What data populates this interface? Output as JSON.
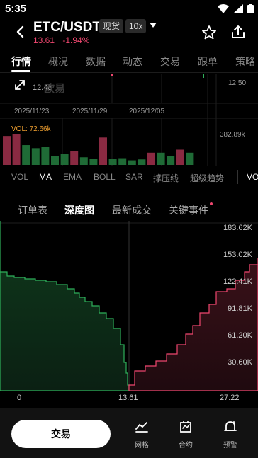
{
  "status": {
    "time": "5:35"
  },
  "header": {
    "pair": "ETC/USDT",
    "market_type": "现货",
    "leverage": "10x",
    "price": "13.61",
    "change": "-1.94%"
  },
  "main_tabs": [
    "行情",
    "概况",
    "数据",
    "动态",
    "交易",
    "跟单",
    "策略"
  ],
  "kline": {
    "price_low_label": "12.48",
    "axis_price": "12.50",
    "watermark": "欧易",
    "dates": [
      "2025/11/23",
      "2025/11/29",
      "2025/12/05"
    ],
    "vol_label": "VOL: 72.66k",
    "vol_axis": "382.89k",
    "volume_bars": [
      {
        "v": 0.95,
        "c": "r"
      },
      {
        "v": 1.0,
        "c": "r"
      },
      {
        "v": 0.65,
        "c": "g"
      },
      {
        "v": 0.55,
        "c": "g"
      },
      {
        "v": 0.6,
        "c": "g"
      },
      {
        "v": 0.3,
        "c": "g"
      },
      {
        "v": 0.35,
        "c": "g"
      },
      {
        "v": 0.45,
        "c": "r"
      },
      {
        "v": 0.25,
        "c": "g"
      },
      {
        "v": 0.2,
        "c": "g"
      },
      {
        "v": 0.9,
        "c": "r"
      },
      {
        "v": 0.2,
        "c": "g"
      },
      {
        "v": 0.22,
        "c": "g"
      },
      {
        "v": 0.15,
        "c": "g"
      },
      {
        "v": 0.18,
        "c": "g"
      },
      {
        "v": 0.4,
        "c": "r"
      },
      {
        "v": 0.4,
        "c": "g"
      },
      {
        "v": 0.28,
        "c": "g"
      },
      {
        "v": 0.5,
        "c": "r"
      },
      {
        "v": 0.4,
        "c": "g"
      }
    ]
  },
  "indicators": [
    "VOL",
    "MA",
    "EMA",
    "BOLL",
    "SAR",
    "撑压线",
    "超级趋势",
    "VO"
  ],
  "sub_tabs": [
    "订单表",
    "深度图",
    "最新成交",
    "关键事件"
  ],
  "depth": {
    "y_ticks": [
      "183.62K",
      "153.02K",
      "122.41K",
      "91.81K",
      "61.20K",
      "30.60K"
    ],
    "x_ticks": [
      "0",
      "13.61",
      "27.22"
    ]
  },
  "bottom": {
    "trade_label": "交易",
    "nav": [
      {
        "label": "网格",
        "icon": "grid-chart-icon"
      },
      {
        "label": "合约",
        "icon": "contract-icon"
      },
      {
        "label": "预警",
        "icon": "alert-bell-icon"
      }
    ]
  },
  "colors": {
    "up": "#2eaf5a",
    "down": "#ef476f",
    "bg": "#000000"
  }
}
